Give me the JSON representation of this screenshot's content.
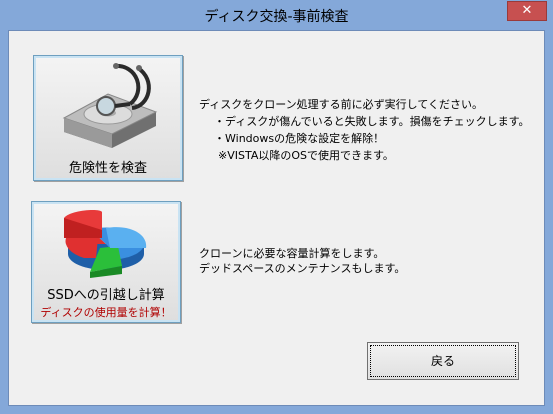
{
  "window": {
    "title": "ディスク交換-事前検査",
    "close_glyph": "✕"
  },
  "diagnose": {
    "button_label": "危険性を検査",
    "icon": "hdd-stethoscope-icon",
    "description": [
      "ディスクをクローン処理する前に必ず実行してください。",
      "・ディスクが傷んでいると失敗します。損傷をチェックします。",
      "・Windowsの危険な設定を解除！",
      "※VISTA以降のOSで使用できます。"
    ]
  },
  "ssd": {
    "button_label": "SSDへの引越し計算",
    "button_sublabel": "ディスクの使用量を計算！",
    "icon": "pie-chart-icon",
    "description": [
      "クローンに必要な容量計算をします。",
      "デッドスペースのメンテナンスもします。"
    ]
  },
  "back_button": {
    "label": "戻る"
  },
  "colors": {
    "frame": "#84a8d9",
    "close": "#c75050",
    "sublabel": "#b00000",
    "pie_red": "#e03030",
    "pie_blue": "#3a8fe0",
    "pie_green": "#2bbf3a"
  }
}
